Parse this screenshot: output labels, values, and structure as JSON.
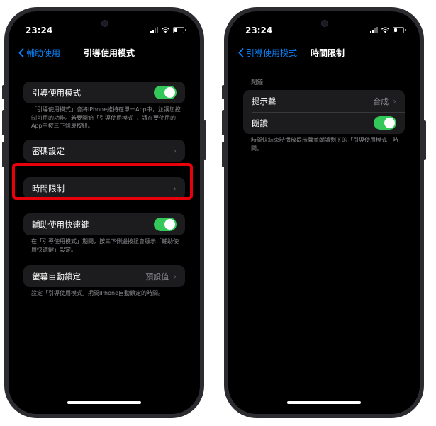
{
  "left": {
    "status_time": "23:24",
    "back_label": "輔助使用",
    "title": "引導使用模式",
    "main_toggle_label": "引導使用模式",
    "main_note": "「引導使用模式」會將iPhone維持在單一App中，並讓您控制可用的功能。若要開始「引導使用模式」，請在要使用的App中按三下側邊按鈕。",
    "passcode_label": "密碼設定",
    "time_limit_label": "時間限制",
    "shortcut_label": "輔助使用快速鍵",
    "shortcut_note": "在「引導使用模式」期間，按三下側邊按鈕會顯示「輔助使用快速鍵」設定。",
    "autolock_label": "螢幕自動鎖定",
    "autolock_value": "預設值",
    "autolock_note": "設定「引導使用模式」期間iPhone自動鎖定的時間。"
  },
  "right": {
    "status_time": "23:24",
    "back_label": "引導使用模式",
    "title": "時間限制",
    "section_header": "鬧鐘",
    "sound_label": "提示聲",
    "sound_value": "合成",
    "speak_label": "朗讀",
    "speak_note": "時間快結束時播放提示聲並朗讀剩下的「引導使用模式」時間。"
  },
  "colors": {
    "accent": "#0a84ff",
    "toggle_on": "#34c759",
    "highlight": "#e8000b"
  }
}
